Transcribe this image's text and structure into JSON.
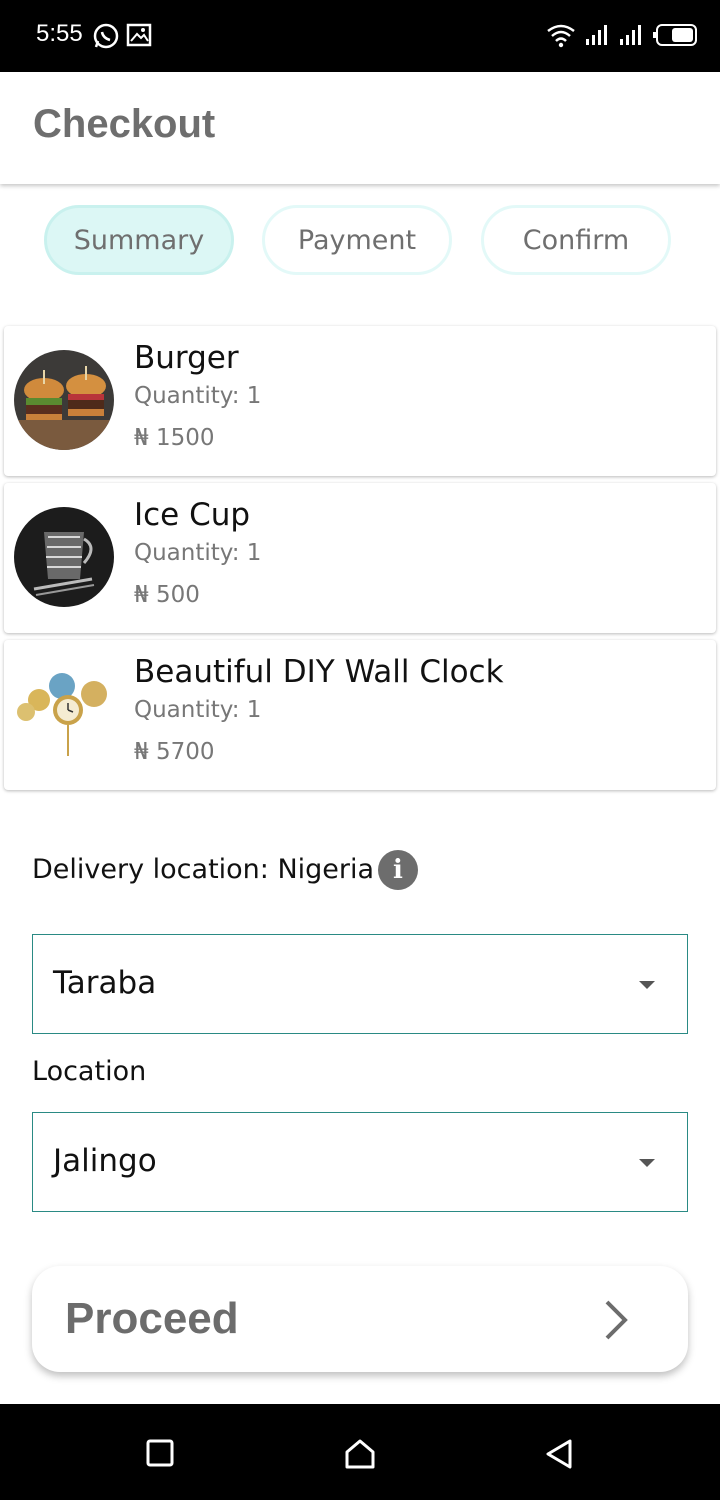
{
  "status_bar": {
    "time": "5:55",
    "left_icons": [
      "whatsapp-icon",
      "image-icon"
    ],
    "right_icons": [
      "wifi-icon",
      "signal-icon",
      "signal-icon",
      "battery-icon"
    ]
  },
  "header": {
    "title": "Checkout"
  },
  "steps": [
    {
      "label": "Summary",
      "active": true
    },
    {
      "label": "Payment",
      "active": false
    },
    {
      "label": "Confirm",
      "active": false
    }
  ],
  "cart": {
    "quantity_label": "Quantity:",
    "currency_symbol": "₦",
    "items": [
      {
        "name": "Burger",
        "quantity": "1",
        "price": "1500"
      },
      {
        "name": "Ice Cup",
        "quantity": "1",
        "price": "500"
      },
      {
        "name": "Beautiful DIY Wall Clock",
        "quantity": "1",
        "price": "5700"
      }
    ]
  },
  "delivery": {
    "label": "Delivery location: Nigeria",
    "info_icon": "info-icon",
    "state_value": "Taraba",
    "location_label": "Location",
    "city_value": "Jalingo"
  },
  "proceed": {
    "label": "Proceed"
  },
  "colors": {
    "accent": "#2a8a84",
    "tab_active": "#dcf7f5",
    "tab_border": "#e3f9f8"
  },
  "nav_bar": {
    "buttons": [
      "recent-apps-icon",
      "home-icon",
      "back-icon"
    ]
  }
}
